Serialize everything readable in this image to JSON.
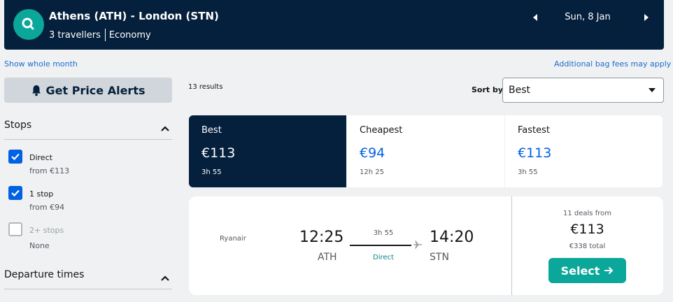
{
  "header": {
    "route": "Athens (ATH) - London (STN)",
    "travellers": "3 travellers",
    "cabin": "Economy",
    "date": "Sun, 8 Jan"
  },
  "links": {
    "show_month": "Show whole month",
    "bag_fees": "Additional bag fees may apply"
  },
  "sidebar": {
    "price_alerts": "Get Price Alerts",
    "stops_title": "Stops",
    "stops": [
      {
        "label": "Direct",
        "sub": "from €113",
        "checked": true
      },
      {
        "label": "1 stop",
        "sub": "from €94",
        "checked": true
      },
      {
        "label": "2+ stops",
        "sub": "None",
        "checked": false
      }
    ],
    "departure_title": "Departure times"
  },
  "results": {
    "count": "13 results",
    "sort_label": "Sort by",
    "sort_value": "Best"
  },
  "tabs": [
    {
      "name": "Best",
      "price": "€113",
      "duration": "3h 55",
      "active": true
    },
    {
      "name": "Cheapest",
      "price": "€94",
      "duration": "12h 25",
      "active": false
    },
    {
      "name": "Fastest",
      "price": "€113",
      "duration": "3h 55",
      "active": false
    }
  ],
  "flight": {
    "airline": "Ryanair",
    "dep_time": "12:25",
    "dep_code": "ATH",
    "arr_time": "14:20",
    "arr_code": "STN",
    "duration": "3h 55",
    "stops": "Direct",
    "deals": "11 deals from",
    "price": "€113",
    "total": "€338 total",
    "select": "Select"
  },
  "colors": {
    "header_bg": "#05203c",
    "accent_teal": "#0aa79a",
    "checkbox_blue": "#0062e3"
  }
}
